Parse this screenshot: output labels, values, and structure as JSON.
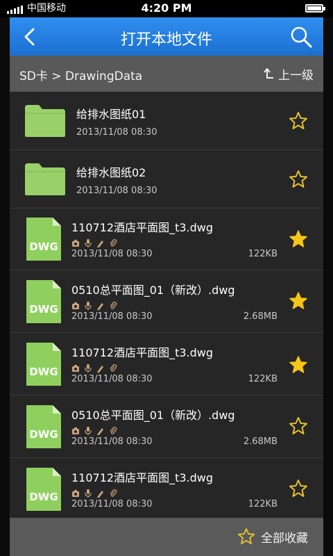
{
  "status_bar": {
    "carrier": "中国移动",
    "time": "4:20 PM"
  },
  "header": {
    "title": "打开本地文件",
    "back_icon": "chevron-left-icon",
    "search_icon": "search-icon"
  },
  "path_bar": {
    "path": "SD卡 > DrawingData",
    "up_label": "上一级",
    "up_icon": "level-up-icon"
  },
  "files": [
    {
      "type": "folder",
      "name": "给排水图纸01",
      "date": "2013/11/08  08:30",
      "size": "",
      "starred": false
    },
    {
      "type": "folder",
      "name": "给排水图纸02",
      "date": "2013/11/08  08:30",
      "size": "",
      "starred": false
    },
    {
      "type": "dwg",
      "icon_label": "DWG",
      "name": "110712酒店平面图_t3.dwg",
      "date": "2013/11/08  08:30",
      "size": "122KB",
      "starred": true
    },
    {
      "type": "dwg",
      "icon_label": "DWG",
      "name": "0510总平面图_01（新改）.dwg",
      "date": "2013/11/08  08:30",
      "size": "2.68MB",
      "starred": true
    },
    {
      "type": "dwg",
      "icon_label": "DWG",
      "name": "110712酒店平面图_t3.dwg",
      "date": "2013/11/08  08:30",
      "size": "122KB",
      "starred": true
    },
    {
      "type": "dwg",
      "icon_label": "DWG",
      "name": "0510总平面图_01（新改）.dwg",
      "date": "2013/11/08  08:30",
      "size": "2.68MB",
      "starred": false
    },
    {
      "type": "dwg",
      "icon_label": "DWG",
      "name": "110712酒店平面图_t3.dwg",
      "date": "2013/11/08  08:30",
      "size": "122KB",
      "starred": false
    }
  ],
  "attachment_icons": [
    "camera-icon",
    "microphone-icon",
    "pen-icon",
    "paperclip-icon"
  ],
  "bottom_bar": {
    "favorites_label": "全部收藏",
    "favorites_icon": "star-outline-icon"
  },
  "colors": {
    "title_bar": "#1f78dc",
    "folder": "#9ad06a",
    "dwg_icon": "#8fcf5e",
    "star_filled": "#f5c518",
    "star_outline": "#e8c22e"
  }
}
